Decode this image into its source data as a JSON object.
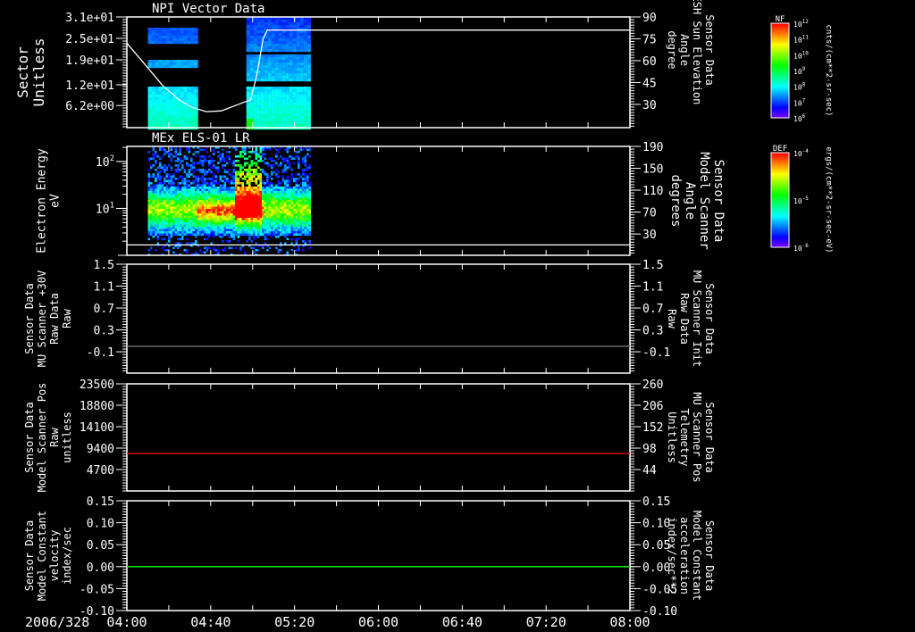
{
  "date_label": "2006/328",
  "time_axis": {
    "start": "04:00",
    "end": "08:00",
    "tick_labels": [
      "04:00",
      "04:40",
      "05:20",
      "06:00",
      "06:40",
      "07:20",
      "08:00"
    ]
  },
  "colors": {
    "line_white": "#ffffff",
    "line_red": "#ff0000",
    "line_green": "#00ff00",
    "line_gray": "#808080",
    "background": "#000000"
  },
  "chart_data": [
    {
      "type": "heatmap",
      "title": "NPI Vector Data",
      "left_axis": {
        "label": [
          "Sector",
          "Unitless"
        ],
        "ticks": [
          "3.1e+01",
          "2.5e+01",
          "1.9e+01",
          "1.2e+01",
          "6.2e+00"
        ],
        "tick_values": [
          31,
          25,
          19,
          12,
          6.2
        ],
        "ylim": [
          0,
          31
        ],
        "scale": "linear"
      },
      "right_axis": {
        "label": [
          "Sensor Data",
          "ESH Sun Elevation",
          "Angle",
          "degree"
        ],
        "ticks": [
          "90",
          "75",
          "60",
          "45",
          "30"
        ],
        "tick_values": [
          90,
          75,
          60,
          45,
          30
        ],
        "ylim": [
          14,
          90
        ],
        "color": "#ffffff"
      },
      "colorbar": {
        "name": "NF",
        "unit": "cnts/(cm**2-sr-sec)",
        "ticks": [
          "10^12",
          "10^11",
          "10^10",
          "10^9",
          "10^8",
          "10^7",
          "10^6"
        ]
      },
      "data_coverage": [
        [
          "04:10",
          "04:33"
        ],
        [
          "04:57",
          "05:26"
        ]
      ],
      "line": {
        "axis": "right",
        "color": "#ffffff",
        "points": [
          [
            "04:00",
            72
          ],
          [
            "04:10",
            55
          ],
          [
            "04:17",
            43
          ],
          [
            "04:25",
            33
          ],
          [
            "04:31",
            28
          ],
          [
            "04:38",
            25
          ],
          [
            "04:45",
            25.5
          ],
          [
            "04:55",
            31
          ],
          [
            "04:59",
            33
          ],
          [
            "05:02",
            50
          ],
          [
            "05:05",
            75
          ],
          [
            "05:07",
            81
          ],
          [
            "08:00",
            81
          ]
        ]
      }
    },
    {
      "type": "heatmap",
      "title": "MEx ELS-01 LR",
      "left_axis": {
        "label": [
          "Electron Energy",
          "eV"
        ],
        "ticks": [
          "10^2",
          "10^1"
        ],
        "tick_values": [
          100,
          10
        ],
        "ylim": [
          1,
          210
        ],
        "scale": "log"
      },
      "right_axis": {
        "label": [
          "Sensor Data",
          "Model Scanner",
          "Angle",
          "degrees"
        ],
        "ticks": [
          "190",
          "150",
          "110",
          "70",
          "30"
        ],
        "tick_values": [
          190,
          150,
          110,
          70,
          30
        ],
        "ylim": [
          -9,
          190
        ],
        "color": "#ffffff"
      },
      "colorbar": {
        "name": "DEF",
        "unit": "ergs/(cm**2-sr-sec-eV)",
        "ticks": [
          "10^-4",
          "10^-5",
          "10^-6"
        ]
      },
      "data_coverage": [
        [
          "04:10",
          "05:27"
        ]
      ],
      "line": {
        "axis": "right",
        "color": "#ffffff",
        "points": [
          [
            "04:00",
            10
          ],
          [
            "08:00",
            10
          ]
        ]
      }
    },
    {
      "type": "line",
      "left_axis": {
        "label": [
          "Sensor Data",
          "MU Scanner +30V",
          "Raw Data",
          "Raw"
        ],
        "ticks": [
          "1.5",
          "1.1",
          "0.7",
          "0.3",
          "-0.1"
        ],
        "tick_values": [
          1.5,
          1.1,
          0.7,
          0.3,
          -0.1
        ],
        "ylim": [
          -0.49,
          1.5
        ],
        "scale": "linear"
      },
      "right_axis": {
        "label": [
          "Sensor Data",
          "MU Scanner Init",
          "Raw Data",
          "Raw"
        ],
        "ticks": [
          "1.5",
          "1.1",
          "0.7",
          "0.3",
          "-0.1"
        ],
        "tick_values": [
          1.5,
          1.1,
          0.7,
          0.3,
          -0.1
        ],
        "ylim": [
          -0.49,
          1.5
        ],
        "color": "#ff0000"
      },
      "line": {
        "axis": "right",
        "color": "#808080",
        "points": [
          [
            "04:00",
            0
          ],
          [
            "08:00",
            0
          ]
        ]
      }
    },
    {
      "type": "line",
      "left_axis": {
        "label": [
          "Sensor Data",
          "Model Scanner Pos",
          "Raw",
          "unitless"
        ],
        "ticks": [
          "23500",
          "18800",
          "14100",
          "9400",
          "4700"
        ],
        "tick_values": [
          23500,
          18800,
          14100,
          9400,
          4700
        ],
        "ylim": [
          0,
          23500
        ],
        "scale": "linear"
      },
      "right_axis": {
        "label": [
          "Sensor Data",
          "MU Scanner Pos",
          "Telemetry",
          "Unitless"
        ],
        "ticks": [
          "260",
          "206",
          "152",
          "98",
          "44"
        ],
        "tick_values": [
          260,
          206,
          152,
          98,
          44
        ],
        "ylim": [
          -10,
          260
        ],
        "color": "#ff0000"
      },
      "line": {
        "axis": "right",
        "color": "#ff0000",
        "points": [
          [
            "04:00",
            84.5
          ],
          [
            "08:00",
            84.5
          ]
        ]
      }
    },
    {
      "type": "line",
      "left_axis": {
        "label": [
          "Sensor Data",
          "Model Constant",
          "velocity",
          "index/sec"
        ],
        "ticks": [
          "0.15",
          "0.10",
          "0.05",
          "0.00",
          "-0.05",
          "-0.10"
        ],
        "tick_values": [
          0.15,
          0.1,
          0.05,
          0.0,
          -0.05,
          -0.1
        ],
        "ylim": [
          -0.1,
          0.15
        ],
        "scale": "linear"
      },
      "right_axis": {
        "label": [
          "Sensor Data",
          "Model Constant",
          "acceleration",
          "index/sec**2"
        ],
        "ticks": [
          "0.15",
          "0.10",
          "0.05",
          "0.00",
          "-0.05",
          "-0.10"
        ],
        "tick_values": [
          0.15,
          0.1,
          0.05,
          0.0,
          -0.05,
          -0.1
        ],
        "ylim": [
          -0.1,
          0.15
        ],
        "color": "#00ff00"
      },
      "line": {
        "axis": "right",
        "color": "#00ff00",
        "points": [
          [
            "04:00",
            0
          ],
          [
            "08:00",
            0
          ]
        ]
      }
    }
  ]
}
